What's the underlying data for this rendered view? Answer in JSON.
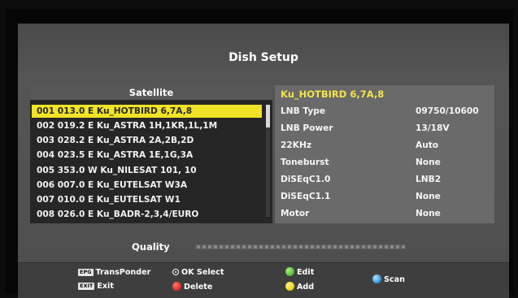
{
  "title": "Dish Setup",
  "satellite_list": {
    "header": "Satellite",
    "selected_index": 0,
    "items": [
      "001 013.0 E  Ku_HOTBIRD 6,7A,8",
      "002 019.2 E  Ku_ASTRA 1H,1KR,1L,1M",
      "003 028.2 E  Ku_ASTRA 2A,2B,2D",
      "004 023.5 E  Ku_ASTRA 1E,1G,3A",
      "005 353.0 W  Ku_NILESAT 101, 10",
      "006 007.0 E  Ku_EUTELSAT W3A",
      "007 010.0 E  Ku_EUTELSAT W1",
      "008 026.0 E  Ku_BADR-2,3,4/EURO"
    ]
  },
  "details": {
    "header": "Ku_HOTBIRD 6,7A,8",
    "rows": [
      {
        "label": "LNB Type",
        "value": "09750/10600"
      },
      {
        "label": "LNB Power",
        "value": "13/18V"
      },
      {
        "label": "22KHz",
        "value": "Auto"
      },
      {
        "label": "Toneburst",
        "value": "None"
      },
      {
        "label": "DiSEqC1.0",
        "value": "LNB2"
      },
      {
        "label": "DiSEqC1.1",
        "value": "None"
      },
      {
        "label": "Motor",
        "value": "None"
      }
    ]
  },
  "quality": {
    "label": "Quality",
    "level": 0
  },
  "footer": {
    "epg_key": "EPG",
    "transponder": "TransPonder",
    "exit_key": "EXIT",
    "exit": "Exit",
    "ok_select": "OK Select",
    "delete": "Delete",
    "edit": "Edit",
    "add": "Add",
    "scan": "Scan"
  },
  "colors": {
    "selected_row": "#f1e325",
    "satellite_text": "#f2f2f2",
    "detail_header": "#f2e34a",
    "red": "#e0342a",
    "green": "#5cc43c",
    "yellow": "#f0d81c",
    "blue": "#3aa0e0"
  }
}
